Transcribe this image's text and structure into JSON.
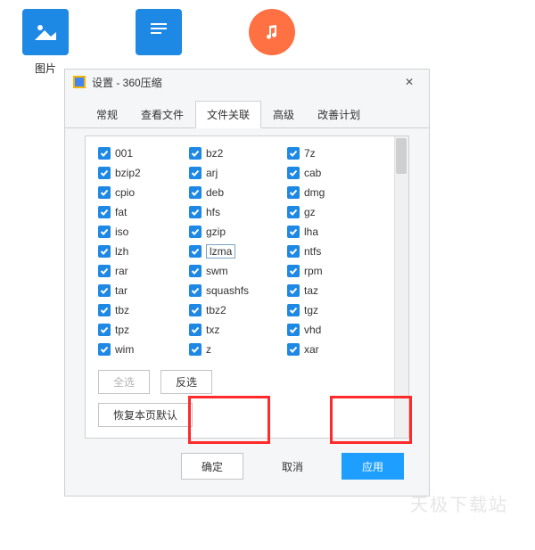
{
  "desktop": {
    "items": [
      {
        "label": "图片",
        "icon": "image-icon"
      },
      {
        "label": "",
        "icon": "document-icon"
      },
      {
        "label": "",
        "icon": "music-icon"
      }
    ]
  },
  "dialog": {
    "title": "设置 - 360压缩",
    "close": "✕",
    "tabs": [
      "常规",
      "查看文件",
      "文件关联",
      "高级",
      "改善计划"
    ],
    "activeTab": 2,
    "columns": [
      [
        "001",
        "bzip2",
        "cpio",
        "fat",
        "iso",
        "lzh",
        "rar",
        "tar",
        "tbz",
        "tpz",
        "wim"
      ],
      [
        "bz2",
        "arj",
        "deb",
        "hfs",
        "gzip",
        "lzma",
        "swm",
        "squashfs",
        "tbz2",
        "txz",
        "z"
      ],
      [
        "7z",
        "cab",
        "dmg",
        "gz",
        "lha",
        "ntfs",
        "rpm",
        "taz",
        "tgz",
        "vhd",
        "xar"
      ]
    ],
    "highlightedItem": "lzma",
    "buttons": {
      "selectAll": "全选",
      "invert": "反选",
      "restore": "恢复本页默认"
    },
    "actions": {
      "ok": "确定",
      "cancel": "取消",
      "apply": "应用"
    }
  },
  "watermark": "天极下载站"
}
